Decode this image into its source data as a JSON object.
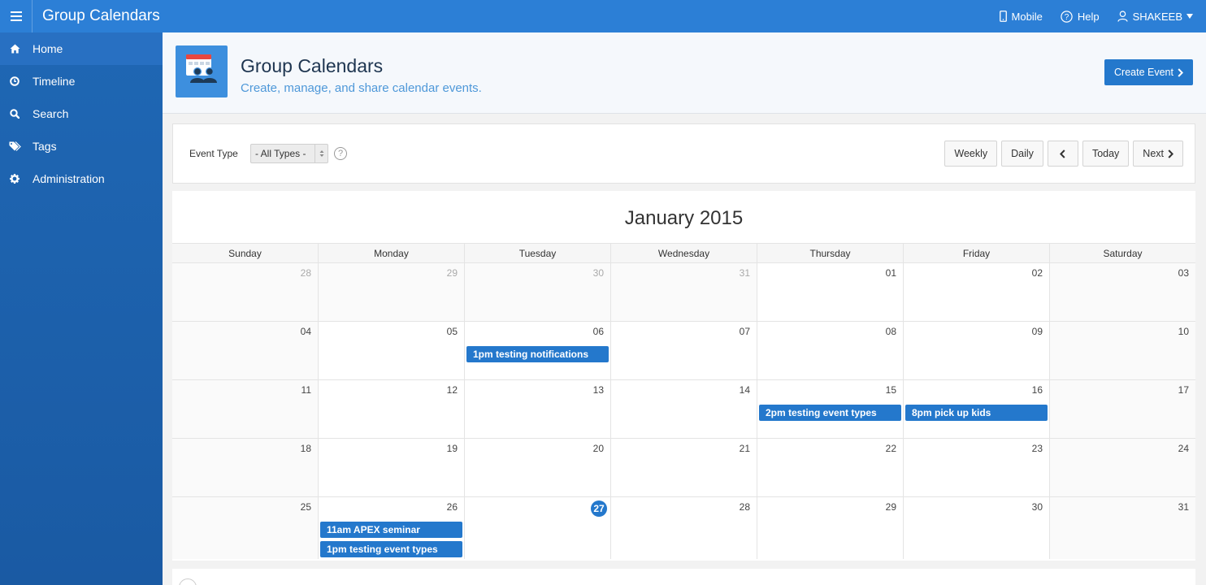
{
  "colors": {
    "brand": "#2c7fd6",
    "accent": "#2478cc",
    "sidebar": "#1f67b4"
  },
  "topbar": {
    "menu_icon": "hamburger-icon",
    "title": "Group Calendars",
    "mobile_label": "Mobile",
    "help_label": "Help",
    "user_label": "SHAKEEB"
  },
  "sidebar": {
    "items": [
      {
        "label": "Home",
        "icon": "home-icon",
        "active": true
      },
      {
        "label": "Timeline",
        "icon": "clock-icon"
      },
      {
        "label": "Search",
        "icon": "search-icon"
      },
      {
        "label": "Tags",
        "icon": "tags-icon"
      },
      {
        "label": "Administration",
        "icon": "gear-icon"
      }
    ]
  },
  "hero": {
    "icon": "group-calendar-icon",
    "title": "Group Calendars",
    "subtitle": "Create, manage, and share calendar events.",
    "create_button": "Create Event"
  },
  "toolbar": {
    "event_type_label": "Event Type",
    "event_type_value": "- All Types -",
    "help_glyph": "?",
    "weekly": "Weekly",
    "daily": "Daily",
    "today": "Today",
    "next": "Next"
  },
  "calendar": {
    "month_title": "January 2015",
    "weekdays": [
      "Sunday",
      "Monday",
      "Tuesday",
      "Wednesday",
      "Thursday",
      "Friday",
      "Saturday"
    ],
    "weeks": [
      [
        "28",
        "29",
        "30",
        "31",
        "01",
        "02",
        "03"
      ],
      [
        "04",
        "05",
        "06",
        "07",
        "08",
        "09",
        "10"
      ],
      [
        "11",
        "12",
        "13",
        "14",
        "15",
        "16",
        "17"
      ],
      [
        "18",
        "19",
        "20",
        "21",
        "22",
        "23",
        "24"
      ],
      [
        "25",
        "26",
        "27",
        "28",
        "29",
        "30",
        "31"
      ]
    ],
    "today": "27",
    "events": [
      {
        "day": "06",
        "text": "1pm testing notifications"
      },
      {
        "day": "15",
        "text": "2pm testing event types"
      },
      {
        "day": "16",
        "text": "8pm pick up kids"
      },
      {
        "day": "26",
        "text": "11am APEX seminar"
      },
      {
        "day": "26",
        "text": "1pm testing event types"
      }
    ]
  }
}
